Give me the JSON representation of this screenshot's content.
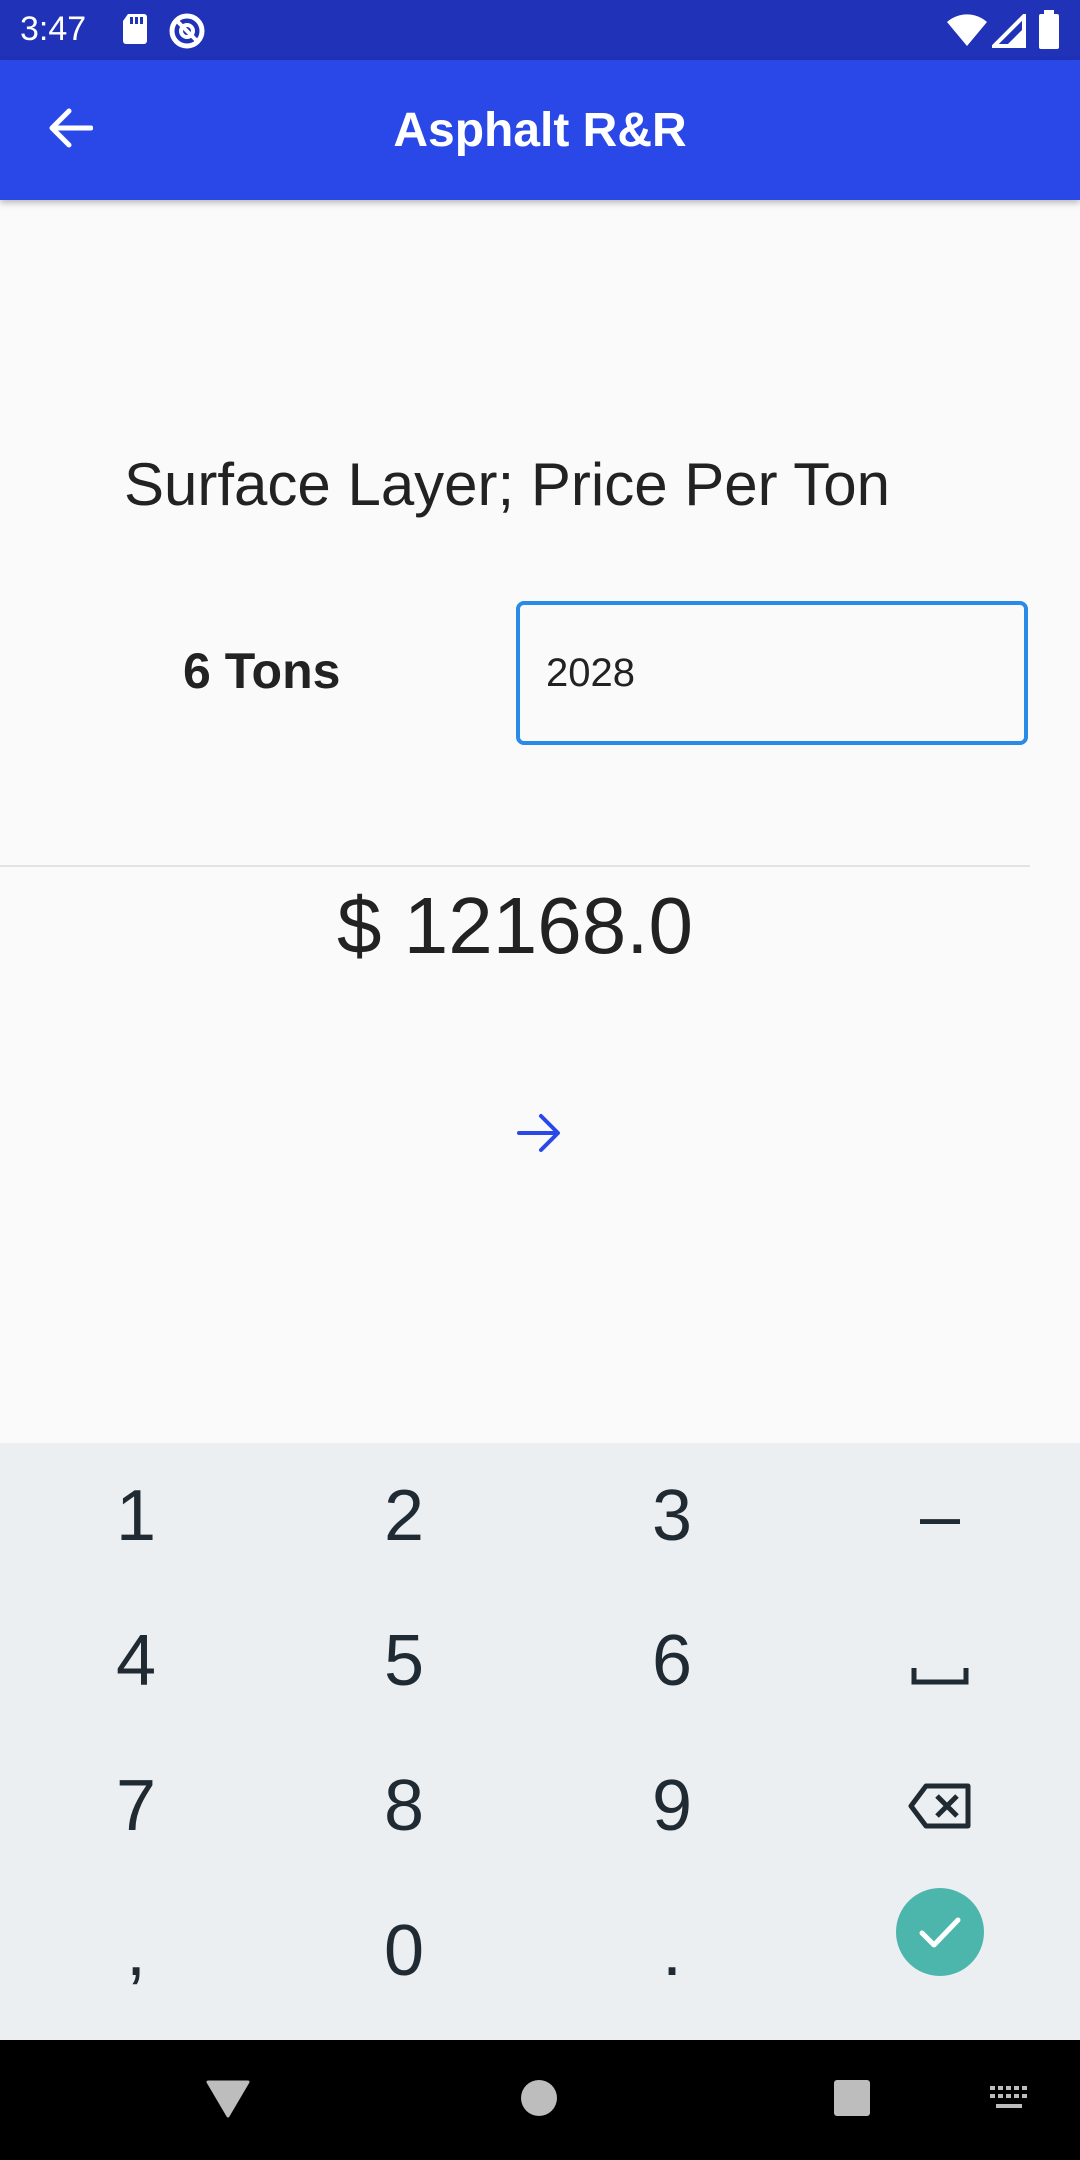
{
  "status_bar": {
    "time": "3:47"
  },
  "app_bar": {
    "title": "Asphalt R&R"
  },
  "form": {
    "heading": "Surface Layer; Price Per Ton",
    "tons_label": "6 Tons",
    "price_value": "2028",
    "total": "$ 12168.0"
  },
  "keyboard": {
    "row1": [
      "1",
      "2",
      "3",
      "–"
    ],
    "row2": [
      "4",
      "5",
      "6"
    ],
    "row3": [
      "7",
      "8",
      "9"
    ],
    "row4": [
      ",",
      "0",
      "."
    ]
  },
  "colors": {
    "status_bar": "#1f32b8",
    "app_bar": "#2a48e8",
    "input_border": "#2a8ae8",
    "accent_arrow": "#2a48e8",
    "done_key": "#4db6ac"
  }
}
